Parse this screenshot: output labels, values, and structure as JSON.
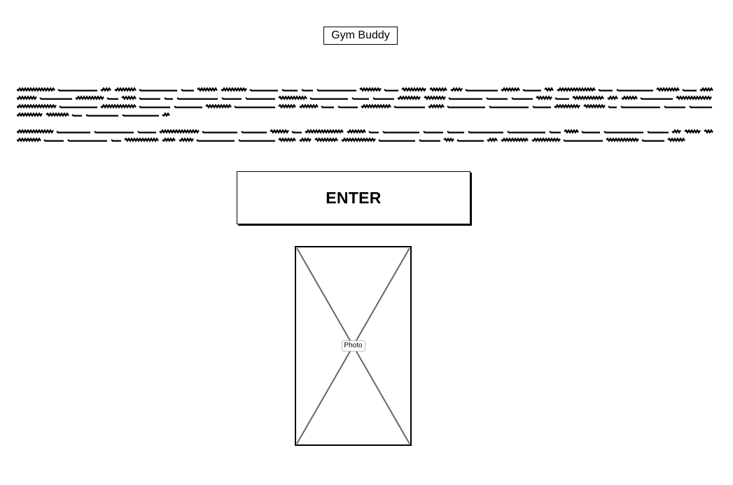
{
  "app": {
    "title": "Gym Buddy"
  },
  "description": {
    "paragraphs": [
      {
        "lines": 4,
        "last_line_fraction": 0.22
      },
      {
        "lines": 2,
        "last_line_fraction": 0.96
      }
    ]
  },
  "actions": {
    "enter_label": "ENTER"
  },
  "media": {
    "photo_label": "Photo"
  },
  "colors": {
    "text": "#000000",
    "placeholder_line": "#666666",
    "background": "#ffffff"
  }
}
